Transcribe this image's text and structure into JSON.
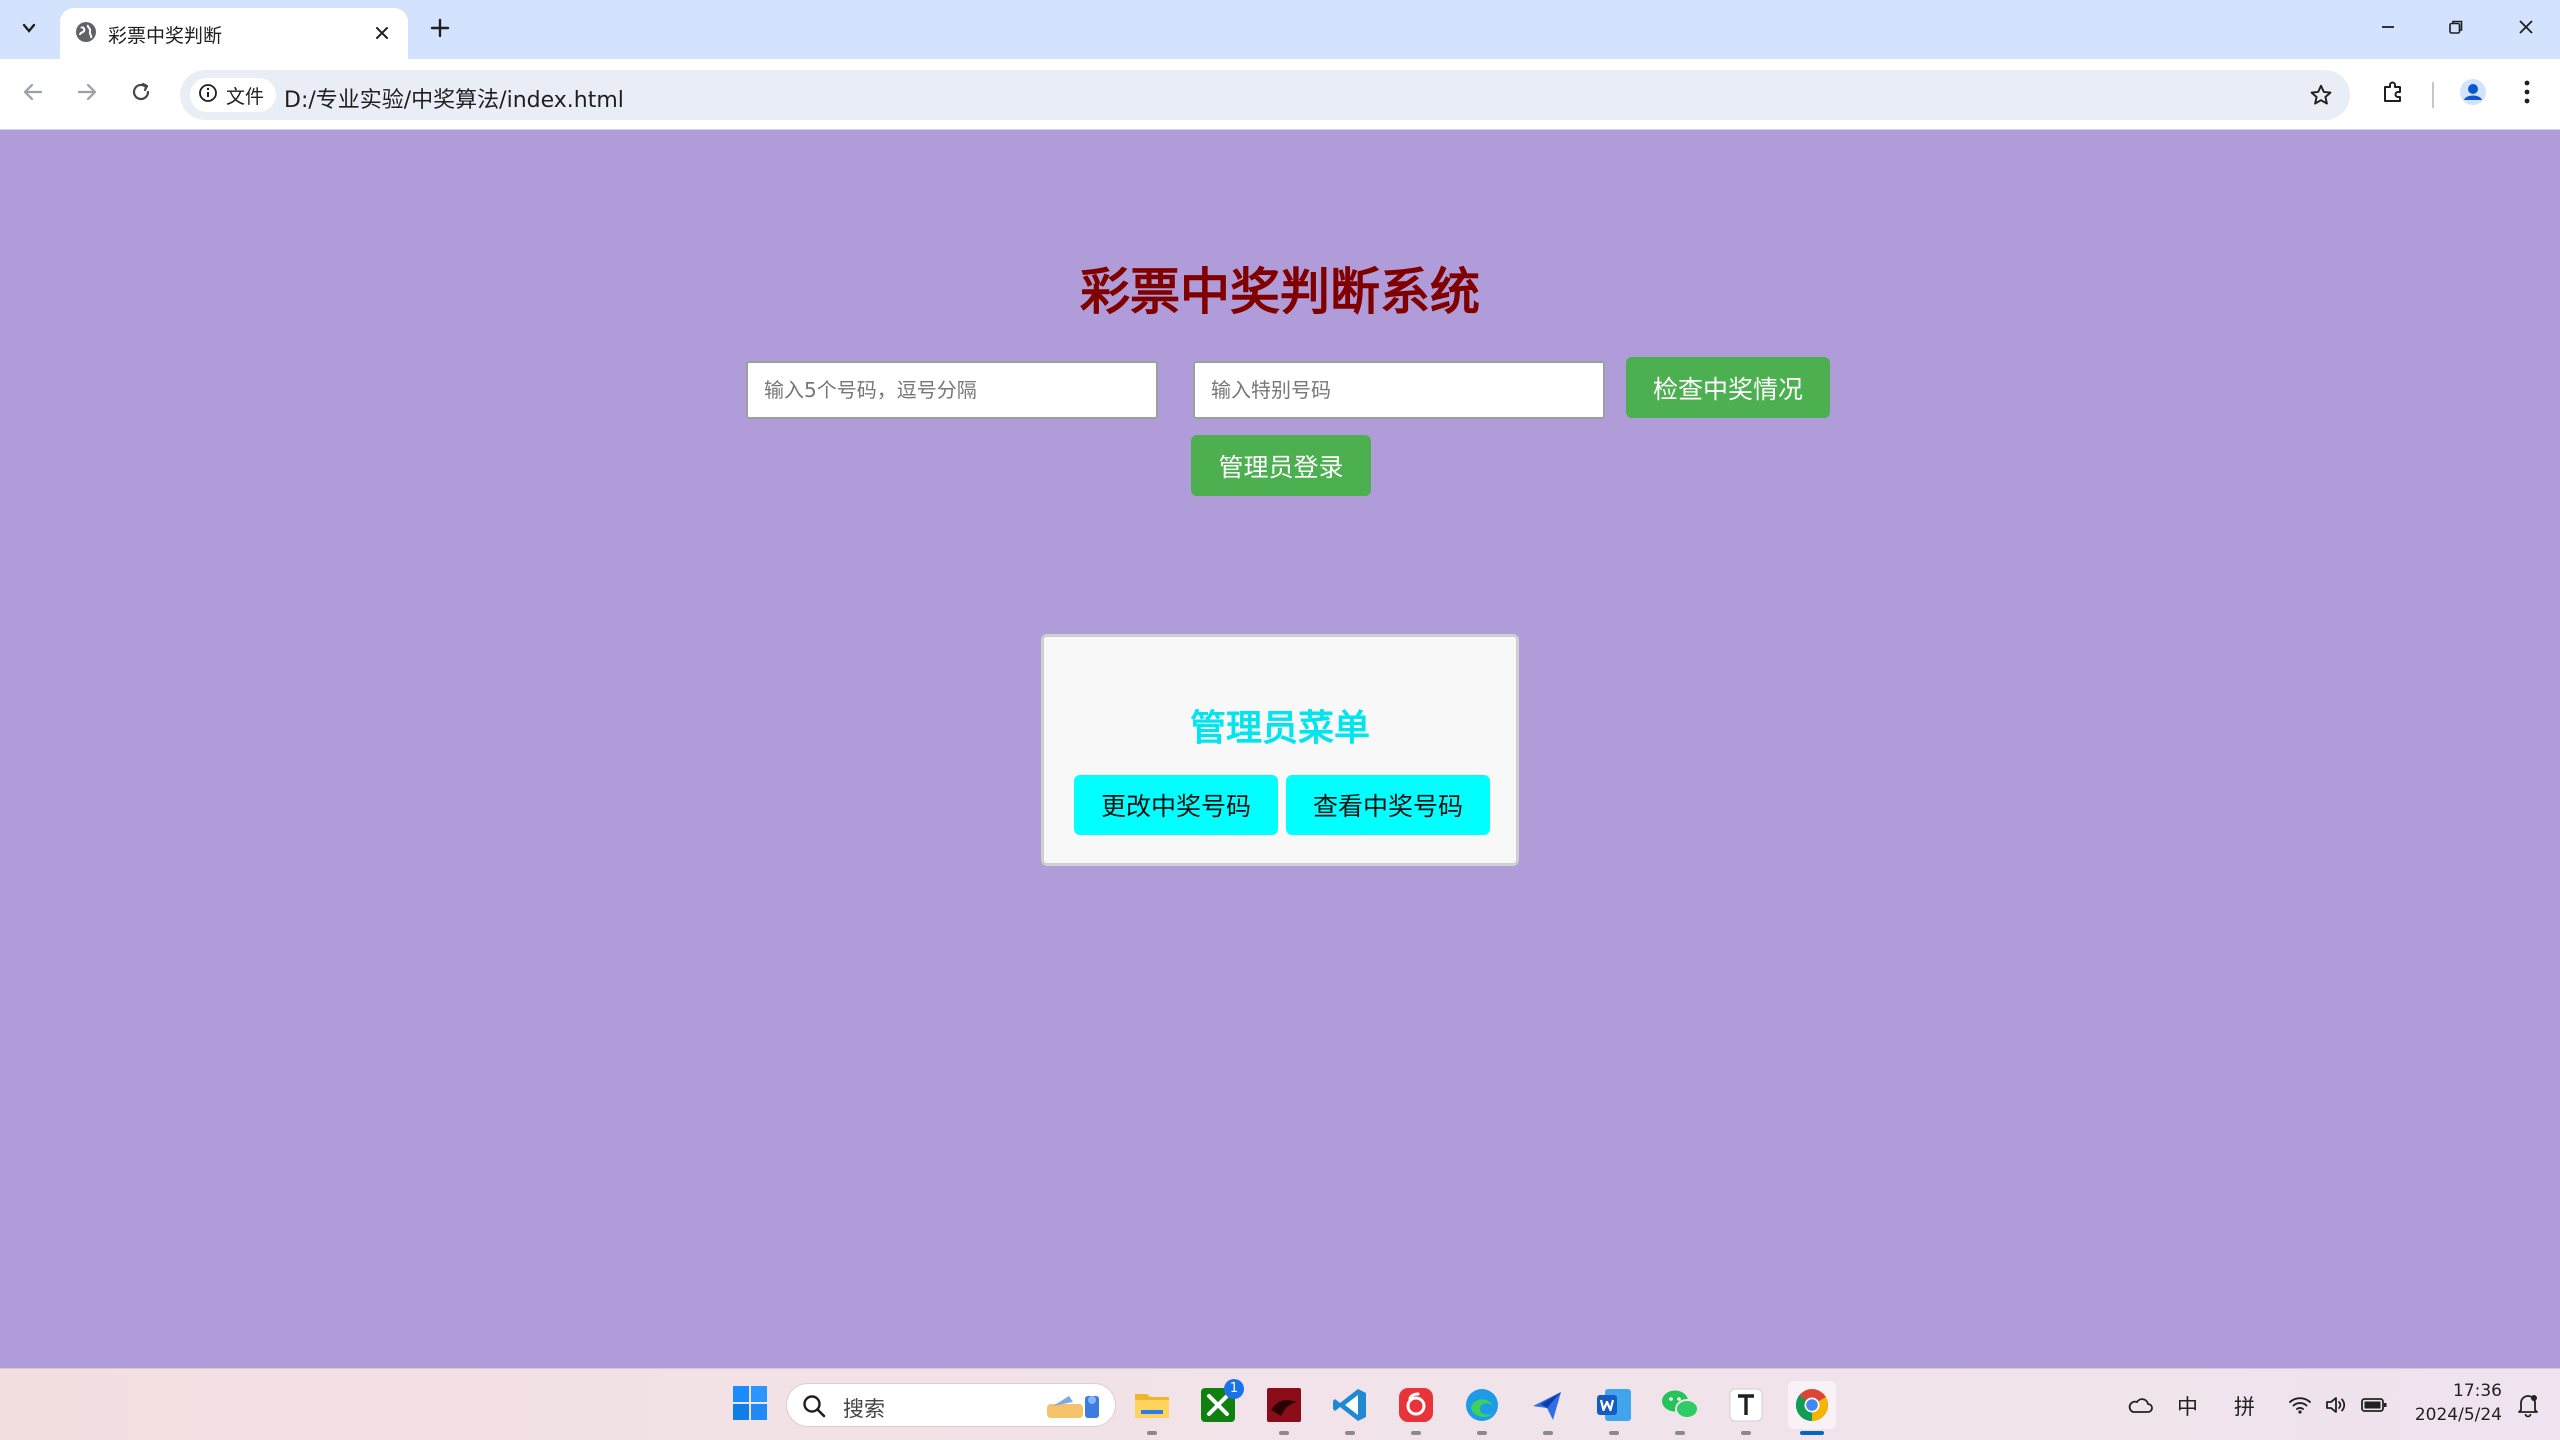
{
  "browser": {
    "tab_title": "彩票中奖判断",
    "site_info_label": "文件",
    "url": "D:/专业实验/中奖算法/index.html"
  },
  "page": {
    "title": "彩票中奖判断系统",
    "numbers_input_placeholder": "输入5个号码，逗号分隔",
    "special_input_placeholder": "输入特别号码",
    "check_button_label": "检查中奖情况",
    "admin_login_button_label": "管理员登录",
    "admin_menu": {
      "title": "管理员菜单",
      "change_button_label": "更改中奖号码",
      "view_button_label": "查看中奖号码"
    }
  },
  "taskbar": {
    "search_label": "搜索",
    "xbox_badge": "1",
    "tray_ime_chinese": "中",
    "tray_ime_pinyin": "拼",
    "time": "17:36",
    "date": "2024/5/24"
  },
  "colors": {
    "page_background": "#b09cd8",
    "title_color": "#800000",
    "green_button": "#4caf50",
    "cyan_button": "#00ffff",
    "admin_title_color": "#00e5ee"
  }
}
